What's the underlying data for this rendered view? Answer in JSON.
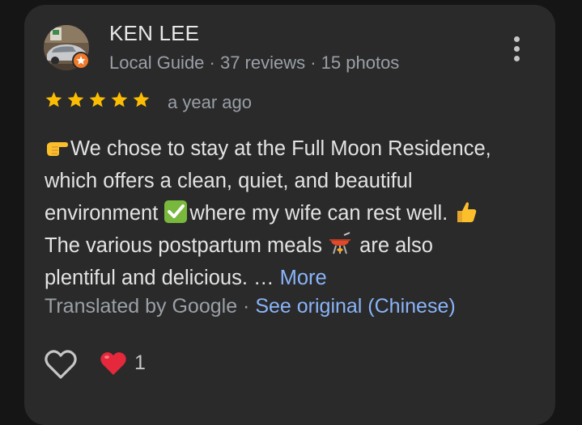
{
  "reviewer": {
    "name": "KEN LEE",
    "meta": "Local Guide · 37 reviews · 15 photos"
  },
  "rating": {
    "stars": 5,
    "date": "a year ago"
  },
  "review": {
    "line1": "We chose to stay at the Full Moon Residence,",
    "line2": "which offers a clean, quiet, and beautiful",
    "line3a": "environment ",
    "line3b": "where my wife can rest well. ",
    "line4a": "The various postpartum meals ",
    "line4b": " are also",
    "line5": "plentiful and delicious. … ",
    "more_label": "More",
    "translated_label": "Translated by Google · ",
    "see_original_label": "See original (Chinese)"
  },
  "reactions": {
    "like_count": "1"
  },
  "icons": {
    "avatar": "profile-photo",
    "badge": "local-guide-badge",
    "menu": "more-vert-icon",
    "star": "star-icon",
    "pointing": "backhand-index-pointing-right-emoji",
    "check": "check-mark-button-emoji",
    "thumbs": "thumbs-up-emoji",
    "fondue": "fondue-pot-emoji",
    "heart_outline": "heart-outline-icon",
    "heart_filled": "red-heart-emoji"
  },
  "colors": {
    "card": "#2a2a2b",
    "star": "#fbbc04",
    "link": "#8ab4f8",
    "secondary": "#9aa0a6",
    "heart": "#e5283b"
  }
}
